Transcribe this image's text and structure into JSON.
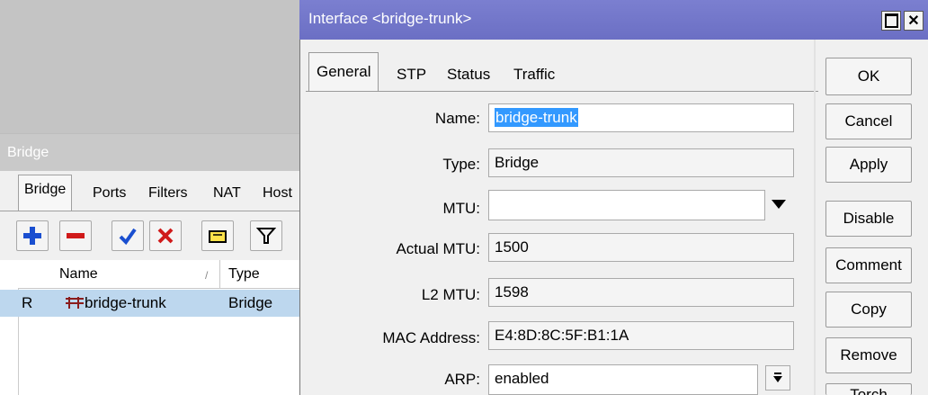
{
  "bridge_window": {
    "title": "Bridge",
    "tabs": [
      "Bridge",
      "Ports",
      "Filters",
      "NAT",
      "Host"
    ],
    "columns": {
      "name": "Name",
      "sort_indicator": "/",
      "type": "Type"
    },
    "rows": [
      {
        "flag": "R",
        "name": "bridge-trunk",
        "type": "Bridge"
      }
    ]
  },
  "dialog": {
    "title": "Interface <bridge-trunk>",
    "tabs": [
      "General",
      "STP",
      "Status",
      "Traffic"
    ],
    "fields": {
      "name": {
        "label": "Name:",
        "value": "bridge-trunk"
      },
      "type": {
        "label": "Type:",
        "value": "Bridge"
      },
      "mtu": {
        "label": "MTU:",
        "value": ""
      },
      "actual_mtu": {
        "label": "Actual MTU:",
        "value": "1500"
      },
      "l2_mtu": {
        "label": "L2 MTU:",
        "value": "1598"
      },
      "mac": {
        "label": "MAC Address:",
        "value": "E4:8D:8C:5F:B1:1A"
      },
      "arp": {
        "label": "ARP:",
        "value": "enabled"
      }
    },
    "buttons": [
      "OK",
      "Cancel",
      "Apply",
      "Disable",
      "Comment",
      "Copy",
      "Remove",
      "Torch"
    ]
  },
  "colors": {
    "title_bar": "#6b6fc4",
    "selection": "#3399ff",
    "row_selected": "#bdd7ee"
  }
}
